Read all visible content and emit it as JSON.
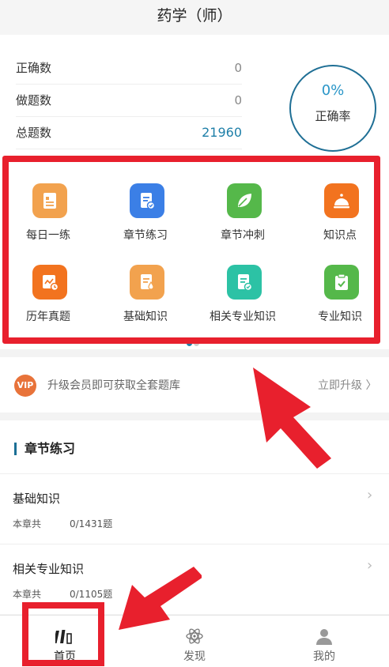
{
  "header": {
    "title": "药学（师）"
  },
  "stats": {
    "correct_label": "正确数",
    "correct_value": "0",
    "done_label": "做题数",
    "done_value": "0",
    "total_label": "总题数",
    "total_value": "21960",
    "rate_percent": "0%",
    "rate_label": "正确率"
  },
  "grid": {
    "items": [
      {
        "label": "每日一练",
        "icon": "daily-practice-icon",
        "color": "#f2a24e"
      },
      {
        "label": "章节练习",
        "icon": "chapter-practice-icon",
        "color": "#3b7fe6"
      },
      {
        "label": "章节冲刺",
        "icon": "leaf-icon",
        "color": "#55b84a"
      },
      {
        "label": "知识点",
        "icon": "bell-icon",
        "color": "#f2731f"
      },
      {
        "label": "历年真题",
        "icon": "past-exam-icon",
        "color": "#f2731f"
      },
      {
        "label": "基础知识",
        "icon": "basic-knowledge-icon",
        "color": "#f2a24e"
      },
      {
        "label": "相关专业知识",
        "icon": "related-knowledge-icon",
        "color": "#2cc2a5"
      },
      {
        "label": "专业知识",
        "icon": "clipboard-check-icon",
        "color": "#55b84a"
      }
    ],
    "page_dots_active": 1,
    "page_dots_total": 2
  },
  "vip": {
    "badge": "VIP",
    "text": "升级会员即可获取全套题库",
    "link": "立即升级 〉"
  },
  "section": {
    "title": "章节练习",
    "chapters": [
      {
        "name": "基础知识",
        "sub": "本章共",
        "progress": "0/1431题"
      },
      {
        "name": "相关专业知识",
        "sub": "本章共",
        "progress": "0/1105题"
      }
    ]
  },
  "tabs": [
    {
      "label": "首页",
      "icon": "books-icon"
    },
    {
      "label": "发现",
      "icon": "atom-icon"
    },
    {
      "label": "我的",
      "icon": "user-icon"
    }
  ],
  "colors": {
    "accent": "#1e7fa8",
    "highlight": "#e8202d"
  }
}
